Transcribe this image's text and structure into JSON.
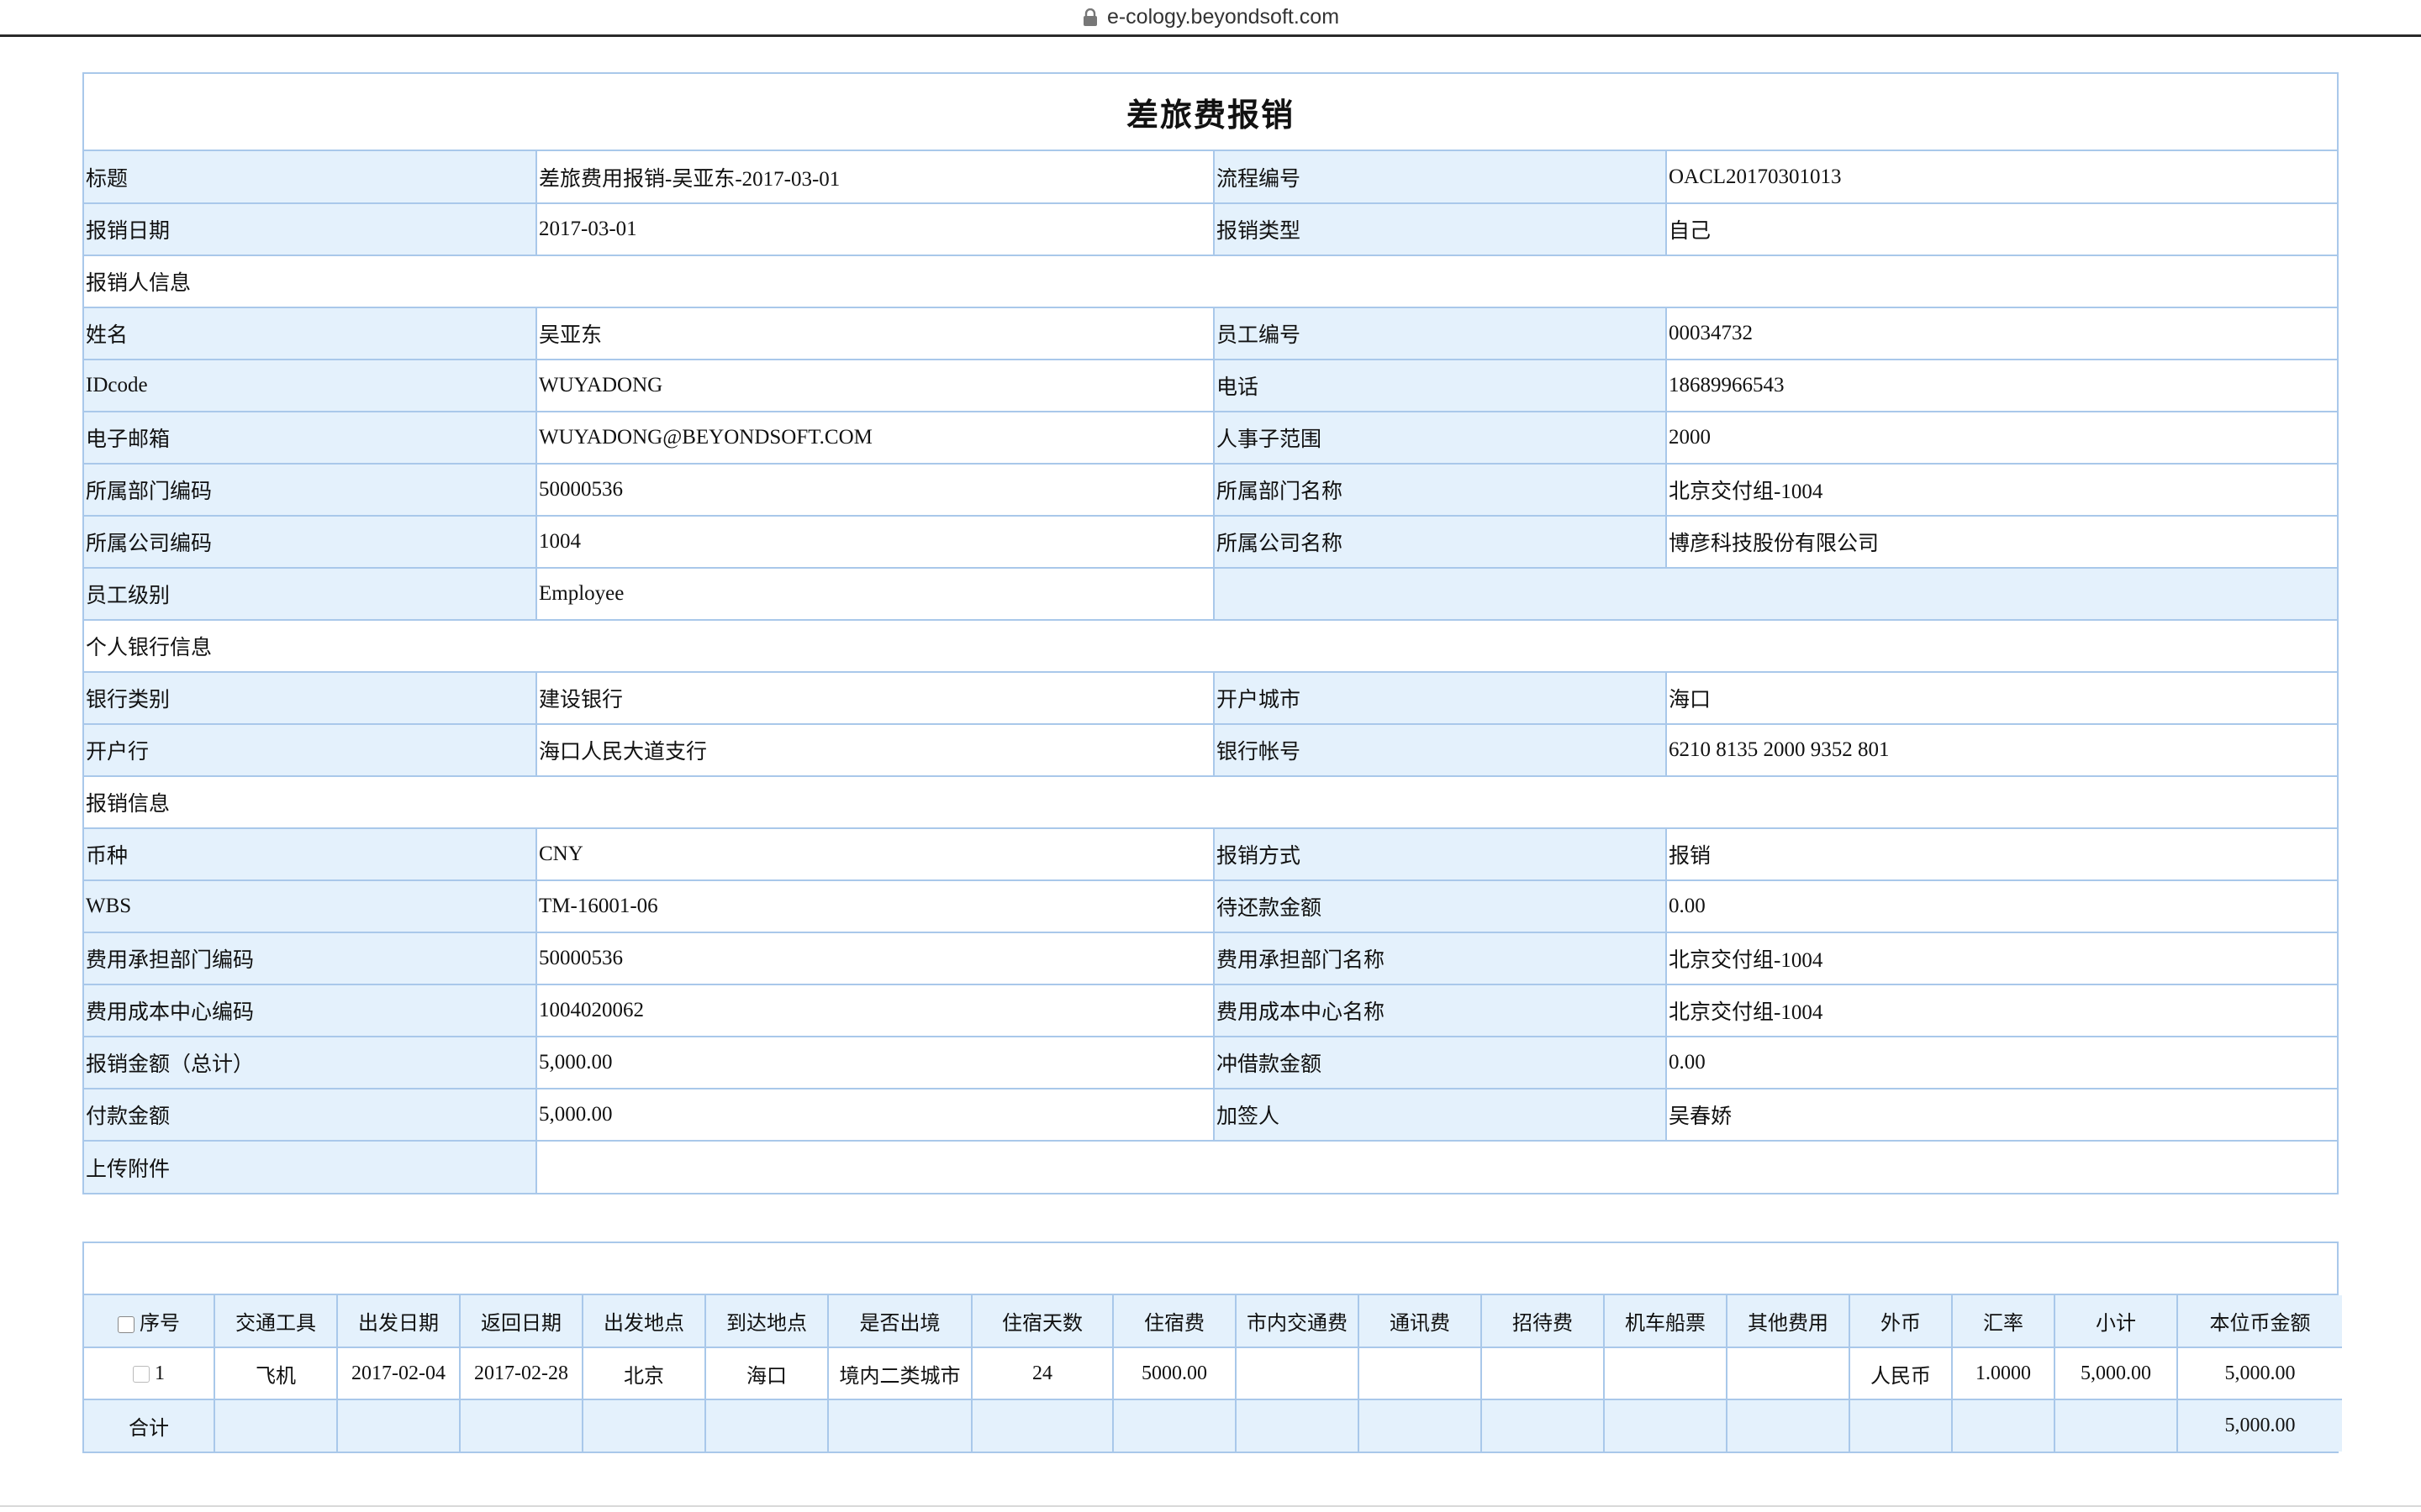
{
  "browser": {
    "url": "e-cology.beyondsoft.com"
  },
  "form": {
    "title": "差旅费报销",
    "rows": [
      {
        "type": "pair",
        "l1": "标题",
        "v1": "差旅费用报销-吴亚东-2017-03-01",
        "l2": "流程编号",
        "v2": "OACL20170301013"
      },
      {
        "type": "pair",
        "l1": "报销日期",
        "v1": "2017-03-01",
        "l2": "报销类型",
        "v2": "自己"
      },
      {
        "type": "section",
        "text": "报销人信息"
      },
      {
        "type": "pair",
        "l1": "姓名",
        "v1": "吴亚东",
        "l2": "员工编号",
        "v2": "00034732"
      },
      {
        "type": "pair",
        "l1": "IDcode",
        "v1": "WUYADONG",
        "l2": "电话",
        "v2": "18689966543"
      },
      {
        "type": "pair",
        "l1": "电子邮箱",
        "v1": "WUYADONG@BEYONDSOFT.COM",
        "l2": "人事子范围",
        "v2": "2000"
      },
      {
        "type": "pair",
        "l1": "所属部门编码",
        "v1": "50000536",
        "l2": "所属部门名称",
        "v2": "北京交付组-1004"
      },
      {
        "type": "pair",
        "l1": "所属公司编码",
        "v1": "1004",
        "l2": "所属公司名称",
        "v2": "博彦科技股份有限公司"
      },
      {
        "type": "single",
        "l1": "员工级别",
        "v1": "Employee"
      },
      {
        "type": "section",
        "text": "个人银行信息"
      },
      {
        "type": "pair",
        "l1": "银行类别",
        "v1": "建设银行",
        "l2": "开户城市",
        "v2": "海口"
      },
      {
        "type": "pair",
        "l1": "开户行",
        "v1": "海口人民大道支行",
        "l2": "银行帐号",
        "v2": "6210 8135 2000 9352 801"
      },
      {
        "type": "section",
        "text": "报销信息"
      },
      {
        "type": "pair",
        "l1": "币种",
        "v1": "CNY",
        "l2": "报销方式",
        "v2": "报销"
      },
      {
        "type": "pair",
        "l1": "WBS",
        "v1": "TM-16001-06",
        "l2": "待还款金额",
        "v2": "0.00"
      },
      {
        "type": "pair",
        "l1": "费用承担部门编码",
        "v1": "50000536",
        "l2": "费用承担部门名称",
        "v2": "北京交付组-1004"
      },
      {
        "type": "pair",
        "l1": "费用成本中心编码",
        "v1": "1004020062",
        "l2": "费用成本中心名称",
        "v2": "北京交付组-1004"
      },
      {
        "type": "pair",
        "l1": "报销金额（总计）",
        "v1": "5,000.00",
        "l2": "冲借款金额",
        "v2": "0.00"
      },
      {
        "type": "pair",
        "l1": "付款金额",
        "v1": "5,000.00",
        "l2": "加签人",
        "v2": "吴春娇"
      },
      {
        "type": "upload",
        "l1": "上传附件"
      }
    ]
  },
  "detail": {
    "headers": [
      "序号",
      "交通工具",
      "出发日期",
      "返回日期",
      "出发地点",
      "到达地点",
      "是否出境",
      "住宿天数",
      "住宿费",
      "市内交通费",
      "通讯费",
      "招待费",
      "机车船票",
      "其他费用",
      "外币",
      "汇率",
      "小计",
      "本位币金额"
    ],
    "rows": [
      [
        "1",
        "飞机",
        "2017-02-04",
        "2017-02-28",
        "北京",
        "海口",
        "境内二类城市",
        "24",
        "5000.00",
        "",
        "",
        "",
        "",
        "",
        "人民币",
        "1.0000",
        "5,000.00",
        "5,000.00"
      ]
    ],
    "total_label": "合计",
    "total_value": "5,000.00"
  }
}
